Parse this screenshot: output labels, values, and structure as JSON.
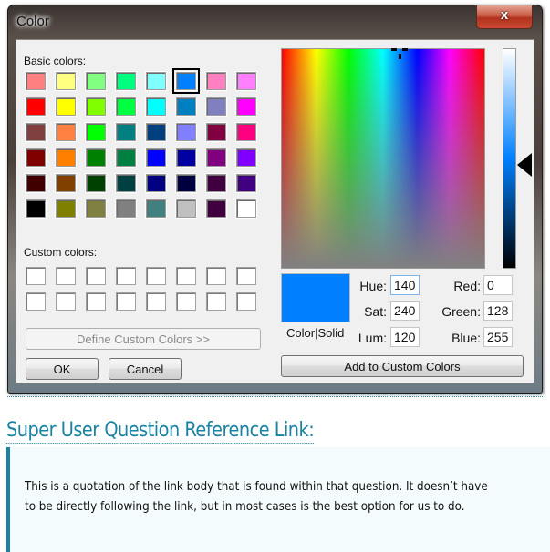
{
  "dialog": {
    "title": "Color",
    "close_label": "x",
    "basic_colors_label": "Basic colors:",
    "custom_colors_label": "Custom colors:",
    "define_custom_label": "Define Custom Colors >>",
    "ok_label": "OK",
    "cancel_label": "Cancel",
    "add_custom_label": "Add to Custom Colors",
    "color_solid_label": "Color|Solid",
    "selected_swatch_index": 5,
    "basic_colors": [
      [
        "#ff8080",
        "#ffff80",
        "#80ff80",
        "#00ff80",
        "#80ffff",
        "#0080ff",
        "#ff80c0",
        "#ff80ff"
      ],
      [
        "#ff0000",
        "#ffff00",
        "#80ff00",
        "#00ff40",
        "#00ffff",
        "#0080c0",
        "#8080c0",
        "#ff00ff"
      ],
      [
        "#804040",
        "#ff8040",
        "#00ff00",
        "#008080",
        "#004080",
        "#8080ff",
        "#800040",
        "#ff0080"
      ],
      [
        "#800000",
        "#ff8000",
        "#008000",
        "#008040",
        "#0000ff",
        "#0000a0",
        "#800080",
        "#8000ff"
      ],
      [
        "#400000",
        "#804000",
        "#004000",
        "#004040",
        "#000080",
        "#000040",
        "#400040",
        "#400080"
      ],
      [
        "#000000",
        "#808000",
        "#808040",
        "#808080",
        "#408080",
        "#c0c0c0",
        "#400040",
        "#ffffff"
      ]
    ],
    "custom_colors": [
      [
        "#ffffff",
        "#ffffff",
        "#ffffff",
        "#ffffff",
        "#ffffff",
        "#ffffff",
        "#ffffff",
        "#ffffff"
      ],
      [
        "#ffffff",
        "#ffffff",
        "#ffffff",
        "#ffffff",
        "#ffffff",
        "#ffffff",
        "#ffffff",
        "#ffffff"
      ]
    ],
    "current_color": "#0080ff",
    "fields": {
      "hue": {
        "label": "Hue:",
        "value": "140"
      },
      "sat": {
        "label": "Sat:",
        "value": "240"
      },
      "lum": {
        "label": "Lum:",
        "value": "120"
      },
      "red": {
        "label": "Red:",
        "value": "0"
      },
      "green": {
        "label": "Green:",
        "value": "128"
      },
      "blue": {
        "label": "Blue:",
        "value": "255"
      }
    }
  },
  "article": {
    "heading": "Super User Question Reference Link:",
    "quote": "This is a quotation of the link body that is found within that question.  It doesn’t have to be directly following the link, but in most cases is the best option for us to do.",
    "accent_color": "#1a83a3"
  }
}
